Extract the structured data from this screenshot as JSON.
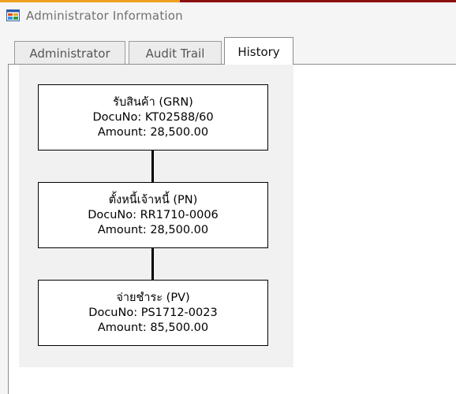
{
  "window": {
    "title": "Administrator Information",
    "icon": "app-window-icon"
  },
  "tabs": [
    {
      "label": "Administrator",
      "active": false
    },
    {
      "label": "Audit Trail",
      "active": false
    },
    {
      "label": "History",
      "active": true
    }
  ],
  "history": {
    "documents": [
      {
        "title": "รับสินค้า (GRN)",
        "docu_no": "DocuNo: KT02588/60",
        "amount": "Amount: 28,500.00"
      },
      {
        "title": "ตั้งหนี้เจ้าหนี้ (PN)",
        "docu_no": "DocuNo: RR1710-0006",
        "amount": "Amount: 28,500.00"
      },
      {
        "title": "จ่ายชำระ (PV)",
        "docu_no": "DocuNo: PS1712-0023",
        "amount": "Amount: 85,500.00"
      }
    ]
  },
  "colors": {
    "title_accent": "#8a1010",
    "title_accent_left": "#f0a020",
    "window_background": "#f5f5f5",
    "history_background": "#f1f1f1"
  }
}
